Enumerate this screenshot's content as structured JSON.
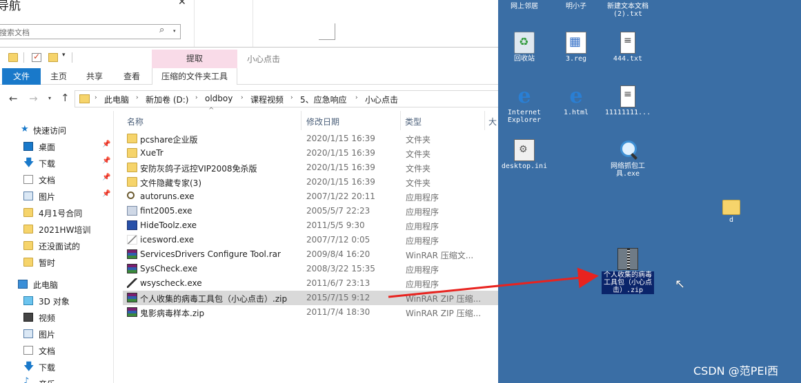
{
  "bg_window": {
    "title": "导航",
    "search_placeholder": "搜索文档",
    "min_glyph": "⌃",
    "close_glyph": "✕",
    "search_glyph": "⌕",
    "caret_glyph": "▾"
  },
  "qat": {
    "dropdown_glyph": "▾",
    "window_title": "小心点击",
    "extract_label": "提取"
  },
  "ribbon": {
    "file": "文件",
    "home": "主页",
    "share": "共享",
    "view": "查看",
    "tools": "压缩的文件夹工具"
  },
  "nav": {
    "back": "←",
    "forward": "→",
    "history": "▾",
    "up": "↑",
    "sep": "›"
  },
  "breadcrumbs": [
    "此电脑",
    "新加卷 (D:)",
    "oldboy",
    "课程视频",
    "5、应急响应",
    "小心点击"
  ],
  "navpane": {
    "items": [
      {
        "label": "快速访问",
        "pinned": false
      },
      {
        "label": "桌面",
        "pinned": true
      },
      {
        "label": "下载",
        "pinned": true
      },
      {
        "label": "文档",
        "pinned": true
      },
      {
        "label": "图片",
        "pinned": true
      },
      {
        "label": "4月1号合同",
        "pinned": false
      },
      {
        "label": "2021HW培训",
        "pinned": false
      },
      {
        "label": "还没面试的",
        "pinned": false
      },
      {
        "label": "暂时",
        "pinned": false
      },
      {
        "label": "此电脑",
        "pinned": false
      },
      {
        "label": "3D 对象",
        "pinned": false
      },
      {
        "label": "视频",
        "pinned": false
      },
      {
        "label": "图片",
        "pinned": false
      },
      {
        "label": "文档",
        "pinned": false
      },
      {
        "label": "下载",
        "pinned": false
      },
      {
        "label": "音乐",
        "pinned": false
      }
    ],
    "pin_glyph": "📌"
  },
  "columns": {
    "name": "名称",
    "date": "修改日期",
    "type": "类型",
    "size": "大"
  },
  "sort_glyph": "^",
  "files": [
    {
      "name": "pcshare企业版",
      "date": "2020/1/15 16:39",
      "type": "文件夹",
      "icon": "folder"
    },
    {
      "name": "XueTr",
      "date": "2020/1/15 16:39",
      "type": "文件夹",
      "icon": "folder"
    },
    {
      "name": "安防灰鸽子远控VIP2008免杀版",
      "date": "2020/1/15 16:39",
      "type": "文件夹",
      "icon": "folder"
    },
    {
      "name": "文件隐藏专家(3)",
      "date": "2020/1/15 16:39",
      "type": "文件夹",
      "icon": "folder"
    },
    {
      "name": "autoruns.exe",
      "date": "2007/1/22 20:11",
      "type": "应用程序",
      "icon": "search"
    },
    {
      "name": "fint2005.exe",
      "date": "2005/5/7 22:23",
      "type": "应用程序",
      "icon": "exe"
    },
    {
      "name": "HideToolz.exe",
      "date": "2011/5/5 9:30",
      "type": "应用程序",
      "icon": "exe-blue"
    },
    {
      "name": "icesword.exe",
      "date": "2007/7/12 0:05",
      "type": "应用程序",
      "icon": "pen"
    },
    {
      "name": "ServicesDrivers Configure Tool.rar",
      "date": "2009/8/4 16:20",
      "type": "WinRAR 压缩文...",
      "icon": "rar"
    },
    {
      "name": "SysCheck.exe",
      "date": "2008/3/22 15:35",
      "type": "应用程序",
      "icon": "rar"
    },
    {
      "name": "wsyscheck.exe",
      "date": "2011/6/7 23:13",
      "type": "应用程序",
      "icon": "wand"
    },
    {
      "name": "个人收集的病毒工具包（小心点击）.zip",
      "date": "2015/7/15 9:12",
      "type": "WinRAR ZIP 压缩...",
      "icon": "rar",
      "selected": true
    },
    {
      "name": "鬼影病毒样本.zip",
      "date": "2011/7/4 18:30",
      "type": "WinRAR ZIP 压缩...",
      "icon": "rar"
    }
  ],
  "desktop": {
    "icons": [
      {
        "label": "网上邻居",
        "img": "none"
      },
      {
        "label": "明小子",
        "img": "none"
      },
      {
        "label": "新建文本文档 (2).txt",
        "img": "none"
      },
      {
        "label": "回收站",
        "img": "recycle"
      },
      {
        "label": "3.reg",
        "img": "reg"
      },
      {
        "label": "444.txt",
        "img": "txt"
      },
      {
        "label": "Internet Explorer",
        "img": "ie"
      },
      {
        "label": "1.html",
        "img": "ie"
      },
      {
        "label": "11111111...",
        "img": "txt"
      },
      {
        "label": "desktop.ini",
        "img": "ini"
      },
      {
        "label": "网络抓包工具.exe",
        "img": "search"
      },
      {
        "label": "d",
        "img": "folder"
      },
      {
        "label": "个人收集的病毒工具包（小心点击）.zip",
        "img": "zip",
        "selected": true
      }
    ],
    "ie_glyph": "e"
  },
  "cursor_glyph": "↖",
  "watermark": "CSDN @范PEI西",
  "colors": {
    "desktop": "#3a6ea5",
    "file_tab": "#1979ca",
    "extract_tab": "#f9dbe8",
    "arrow": "#e8231f"
  }
}
